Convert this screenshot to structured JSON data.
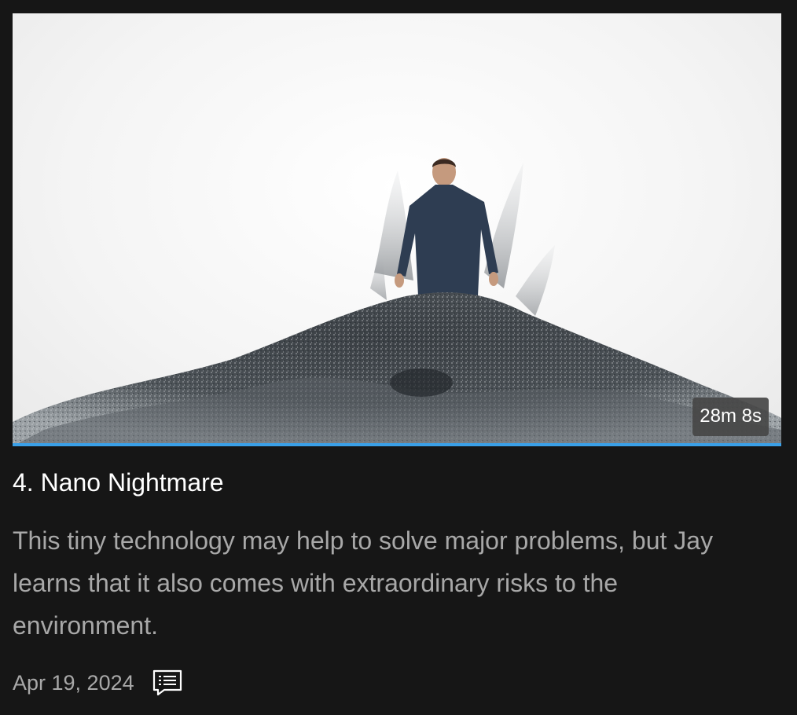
{
  "episode": {
    "thumbnail_alt": "",
    "duration": "28m 8s",
    "watch_progress_percent": 100,
    "title": "4. Nano Nightmare",
    "description": "This tiny technology may help to solve major problems, but Jay learns that it also comes with extraordinary risks to the environment.",
    "date": "Apr 19, 2024",
    "transcript_icon": "transcript-icon"
  },
  "colors": {
    "background": "#161616",
    "progress": "#3aa0e8",
    "secondary_text": "#a8a8a8"
  }
}
